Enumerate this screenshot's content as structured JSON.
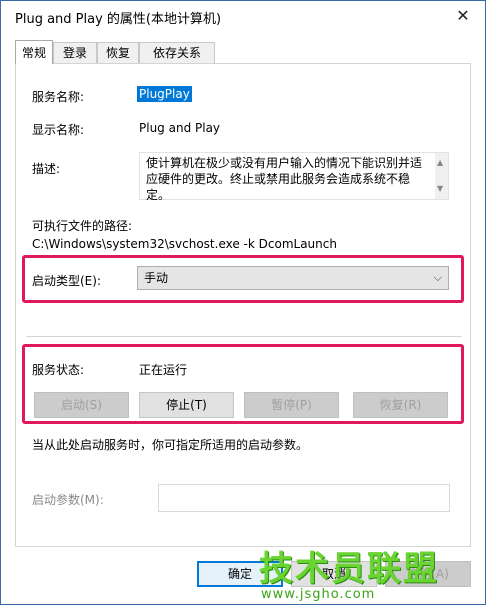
{
  "window": {
    "title": "Plug and Play 的属性(本地计算机)",
    "close_glyph": "✕"
  },
  "tabs": [
    {
      "label": "常规",
      "active": true
    },
    {
      "label": "登录",
      "active": false
    },
    {
      "label": "恢复",
      "active": false
    },
    {
      "label": "依存关系",
      "active": false
    }
  ],
  "general": {
    "service_name_label": "服务名称:",
    "service_name_value": "PlugPlay",
    "display_name_label": "显示名称:",
    "display_name_value": "Plug and Play",
    "description_label": "描述:",
    "description_value": "使计算机在极少或没有用户输入的情况下能识别并适应硬件的更改。终止或禁用此服务会造成系统不稳定。",
    "path_label": "可执行文件的路径:",
    "path_value": "C:\\Windows\\system32\\svchost.exe -k DcomLaunch",
    "startup_type_label": "启动类型(E):",
    "startup_type_value": "手动",
    "service_status_label": "服务状态:",
    "service_status_value": "正在运行",
    "start_hint": "当从此处启动服务时，你可指定所适用的启动参数。",
    "start_params_label": "启动参数(M):",
    "start_params_value": ""
  },
  "service_buttons": {
    "start": "启动(S)",
    "stop": "停止(T)",
    "pause": "暂停(P)",
    "resume": "恢复(R)"
  },
  "dialog_buttons": {
    "ok": "确定",
    "cancel": "取消",
    "apply": "应用(A)"
  },
  "highlight_color": "#e0195a",
  "watermark": {
    "title": "技术员联盟",
    "url": "www.jsgho.com"
  }
}
